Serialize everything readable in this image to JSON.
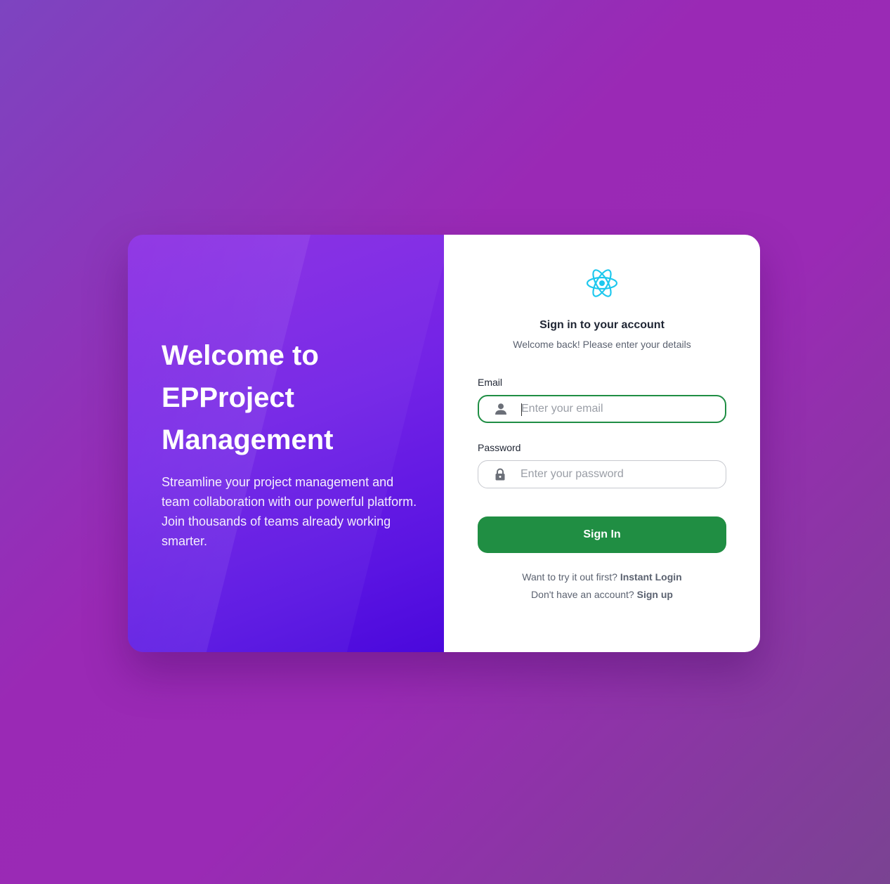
{
  "hero": {
    "title_line1": "Welcome to",
    "title_line2": "EPProject",
    "title_line3": "Management",
    "description": "Streamline your project management and team collaboration with our powerful platform. Join thousands of teams already working smarter."
  },
  "signin": {
    "logo_icon": "react-atom-icon",
    "title": "Sign in to your account",
    "subtitle": "Welcome back! Please enter your details",
    "email": {
      "label": "Email",
      "placeholder": "Enter your email",
      "value": "",
      "icon": "user-icon"
    },
    "password": {
      "label": "Password",
      "placeholder": "Enter your password",
      "value": "",
      "icon": "lock-icon"
    },
    "button_label": "Sign In",
    "instant_prompt": "Want to try it out first?",
    "instant_link": "Instant Login",
    "signup_prompt": "Don't have an account?",
    "signup_link": "Sign up"
  },
  "colors": {
    "primary_button": "#208e43",
    "focus_border": "#1f8e44",
    "logo": "#1ec8ee",
    "hero_gradient_start": "#8a2be2",
    "hero_gradient_end": "#4a08dc"
  }
}
